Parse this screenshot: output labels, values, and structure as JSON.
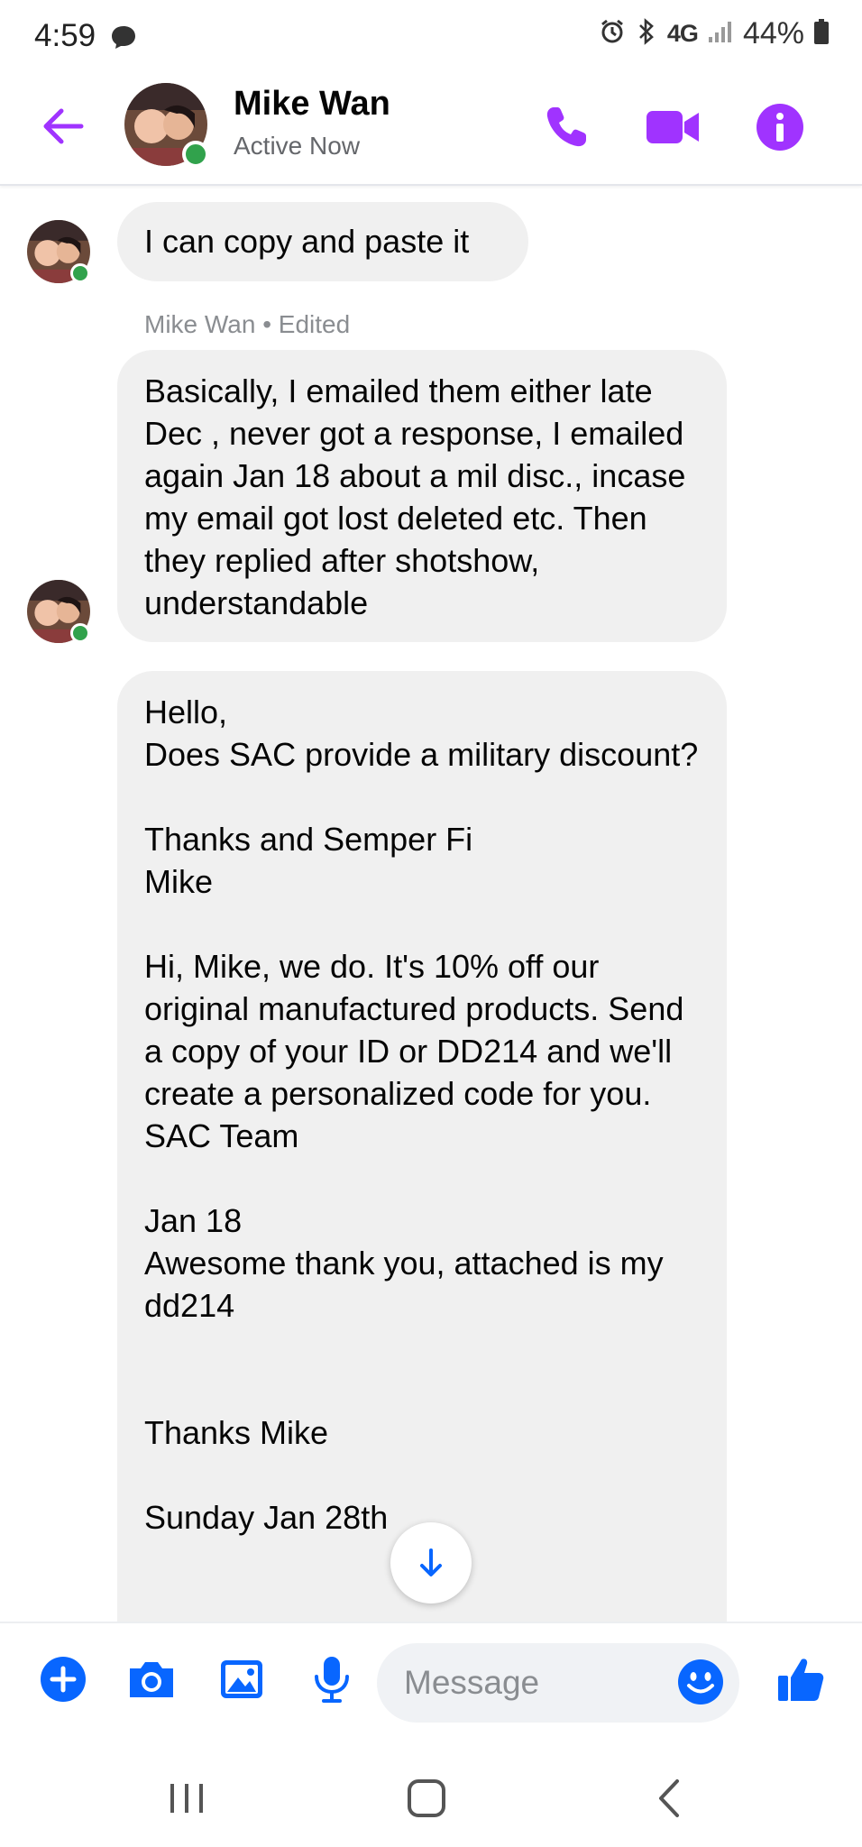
{
  "status_bar": {
    "time": "4:59",
    "network": "4G",
    "battery": "44%"
  },
  "header": {
    "contact_name": "Mike Wan",
    "contact_status": "Active Now"
  },
  "messages": [
    {
      "text": "I can copy and paste it"
    },
    {
      "meta": "Mike Wan • Edited",
      "text": "Basically, I emailed them either late Dec , never got a response, I emailed  again Jan 18 about a mil disc., incase my email got lost deleted etc. Then they replied after shotshow, understandable"
    },
    {
      "text": "Hello,\nDoes SAC provide a military discount?\n\nThanks and Semper Fi\n Mike\n\nHi, Mike, we do.  It's 10% off our original manufactured products. Send a copy of your ID or DD214 and we'll create a personalized code for you.\nSAC Team\n\nJan 18\nAwesome thank you, attached is my dd214\n\n\nThanks Mike\n\nSunday Jan 28th"
    }
  ],
  "composer": {
    "placeholder": "Message"
  },
  "colors": {
    "accent_purple": "#a033ff",
    "messenger_blue": "#0866ff",
    "online_green": "#31a24c",
    "bubble_gray": "#f0f0f0"
  },
  "icons": {
    "header": [
      "back-arrow-icon",
      "phone-icon",
      "video-camera-icon",
      "info-icon"
    ],
    "composer": [
      "plus-icon",
      "camera-icon",
      "image-icon",
      "microphone-icon",
      "emoji-icon",
      "thumbs-up-icon"
    ],
    "navbar": [
      "recent-apps-icon",
      "home-icon",
      "back-icon"
    ]
  }
}
